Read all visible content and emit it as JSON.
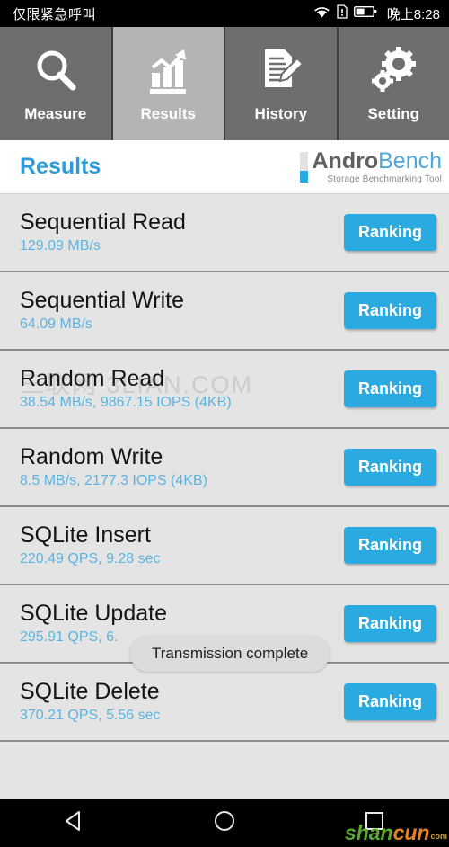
{
  "statusbar": {
    "carrier": "仅限紧急呼叫",
    "time": "晚上8:28",
    "icons": [
      "wifi-icon",
      "sim-alert-icon",
      "battery-icon"
    ]
  },
  "tabs": [
    {
      "label": "Measure",
      "icon": "magnifier-icon",
      "active": false
    },
    {
      "label": "Results",
      "icon": "bar-chart-arrow-icon",
      "active": true
    },
    {
      "label": "History",
      "icon": "document-pencil-icon",
      "active": false
    },
    {
      "label": "Setting",
      "icon": "gears-icon",
      "active": false
    }
  ],
  "header": {
    "title": "Results",
    "logo_andro": "Andro",
    "logo_bench": "Bench",
    "logo_sub": "Storage Benchmarking Tool"
  },
  "results": [
    {
      "title": "Sequential Read",
      "value": "129.09 MB/s",
      "button": "Ranking"
    },
    {
      "title": "Sequential Write",
      "value": "64.09 MB/s",
      "button": "Ranking"
    },
    {
      "title": "Random Read",
      "value": "38.54 MB/s, 9867.15 IOPS (4KB)",
      "button": "Ranking"
    },
    {
      "title": "Random Write",
      "value": "8.5 MB/s, 2177.3 IOPS (4KB)",
      "button": "Ranking"
    },
    {
      "title": "SQLite Insert",
      "value": "220.49 QPS, 9.28 sec",
      "button": "Ranking"
    },
    {
      "title": "SQLite Update",
      "value": "295.91 QPS, 6.",
      "button": "Ranking"
    },
    {
      "title": "SQLite Delete",
      "value": "370.21 QPS, 5.56 sec",
      "button": "Ranking"
    }
  ],
  "toast": {
    "message": "Transmission complete"
  },
  "watermarks": {
    "list": "三联网 3LIAN.COM",
    "nav_part1": "shan",
    "nav_part2": "cun",
    "nav_part3": "com"
  },
  "navbar": {
    "back": "back-triangle-icon",
    "home": "home-circle-icon",
    "recents": "recents-square-icon"
  },
  "colors": {
    "accent": "#29abe2",
    "title": "#2e9bd6",
    "value": "#5ab4e0",
    "tab_active": "#b4b4b4",
    "tab_inactive": "#6e6e6e",
    "list_bg": "#e4e4e4"
  }
}
